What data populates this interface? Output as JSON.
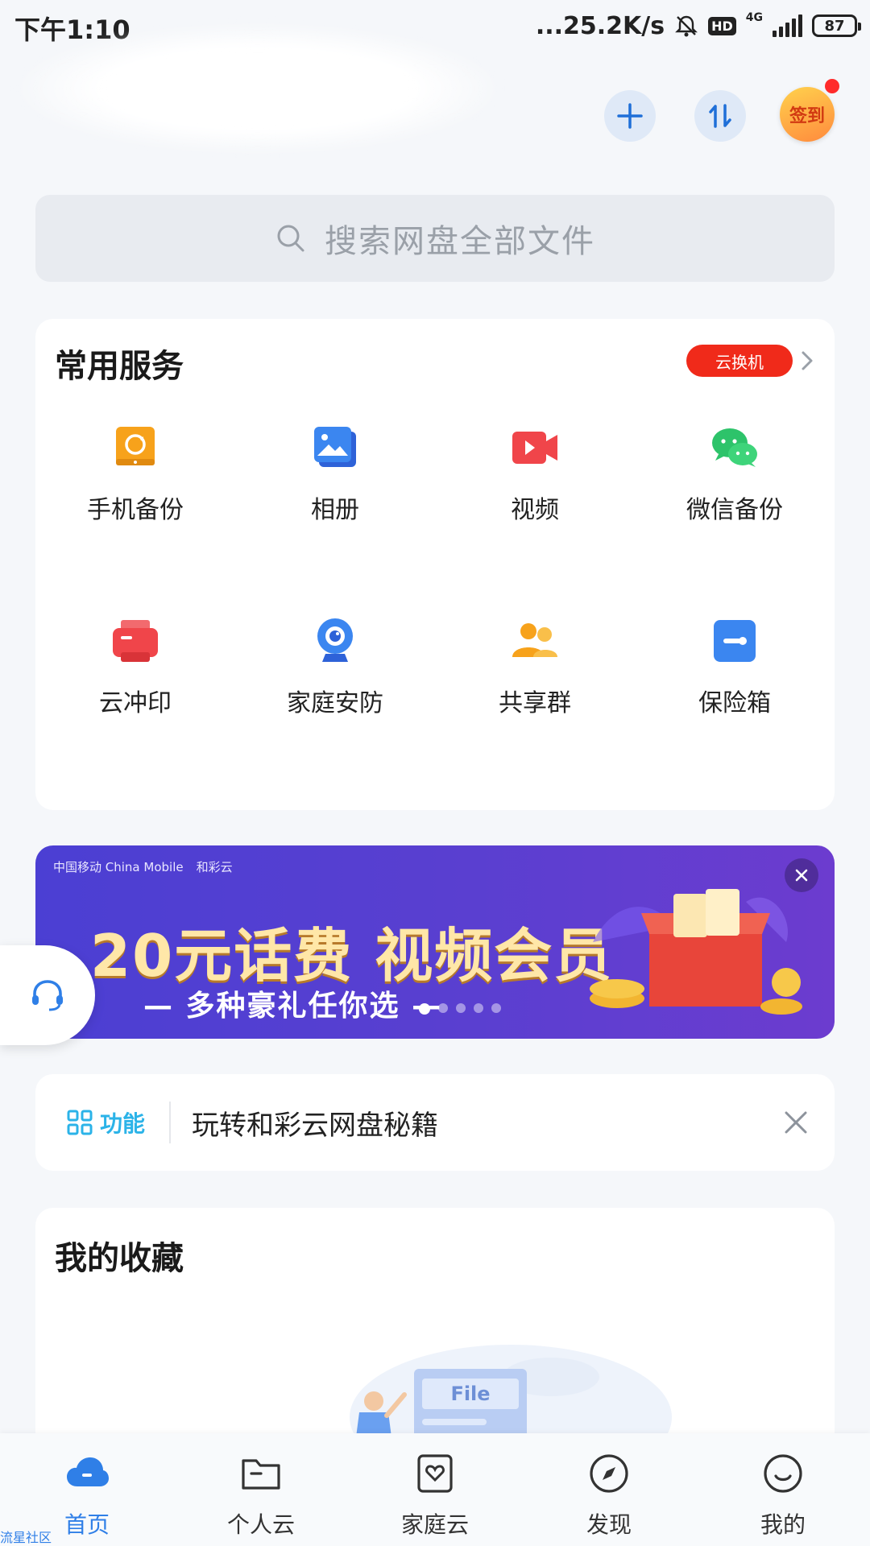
{
  "status_bar": {
    "time": "下午1:10",
    "speed": "...25.2K/s",
    "hd": "HD",
    "network": "4G",
    "battery": "87"
  },
  "header": {
    "signin_label": "签到"
  },
  "search": {
    "placeholder": "搜索网盘全部文件"
  },
  "services": {
    "title": "常用服务",
    "tag": "云换机",
    "items": [
      {
        "label": "手机备份",
        "icon": "phone-backup-icon",
        "color": "#F7A21B"
      },
      {
        "label": "相册",
        "icon": "album-icon",
        "color": "#3B7CF0"
      },
      {
        "label": "视频",
        "icon": "video-icon",
        "color": "#F0454A"
      },
      {
        "label": "微信备份",
        "icon": "wechat-icon",
        "color": "#2DC36A"
      },
      {
        "label": "云冲印",
        "icon": "print-icon",
        "color": "#F0454A"
      },
      {
        "label": "家庭安防",
        "icon": "camera-icon",
        "color": "#3B86F0"
      },
      {
        "label": "共享群",
        "icon": "group-icon",
        "color": "#F7A21B"
      },
      {
        "label": "保险箱",
        "icon": "safe-icon",
        "color": "#3B7CF0"
      }
    ]
  },
  "banner": {
    "brand_left": "中国移动 China Mobile",
    "brand_right": "和彩云",
    "title": "20元话费 视频会员",
    "subtitle": "— 多种豪礼任你选 —",
    "dots": 5,
    "active_dot": 0
  },
  "tips": {
    "tag": "功能",
    "text": "玩转和彩云网盘秘籍"
  },
  "favorites": {
    "title": "我的收藏",
    "illustration_text": "File"
  },
  "bottom_nav": {
    "items": [
      {
        "label": "首页",
        "icon": "cloud-home-icon",
        "active": true
      },
      {
        "label": "个人云",
        "icon": "folder-icon",
        "active": false
      },
      {
        "label": "家庭云",
        "icon": "family-cloud-icon",
        "active": false
      },
      {
        "label": "发现",
        "icon": "compass-icon",
        "active": false
      },
      {
        "label": "我的",
        "icon": "smile-icon",
        "active": false
      }
    ]
  },
  "watermark": "流星社区",
  "colors": {
    "accent": "#2F7FE7",
    "tag_red": "#F02A1A",
    "banner_purple": "#4B3FD3"
  }
}
